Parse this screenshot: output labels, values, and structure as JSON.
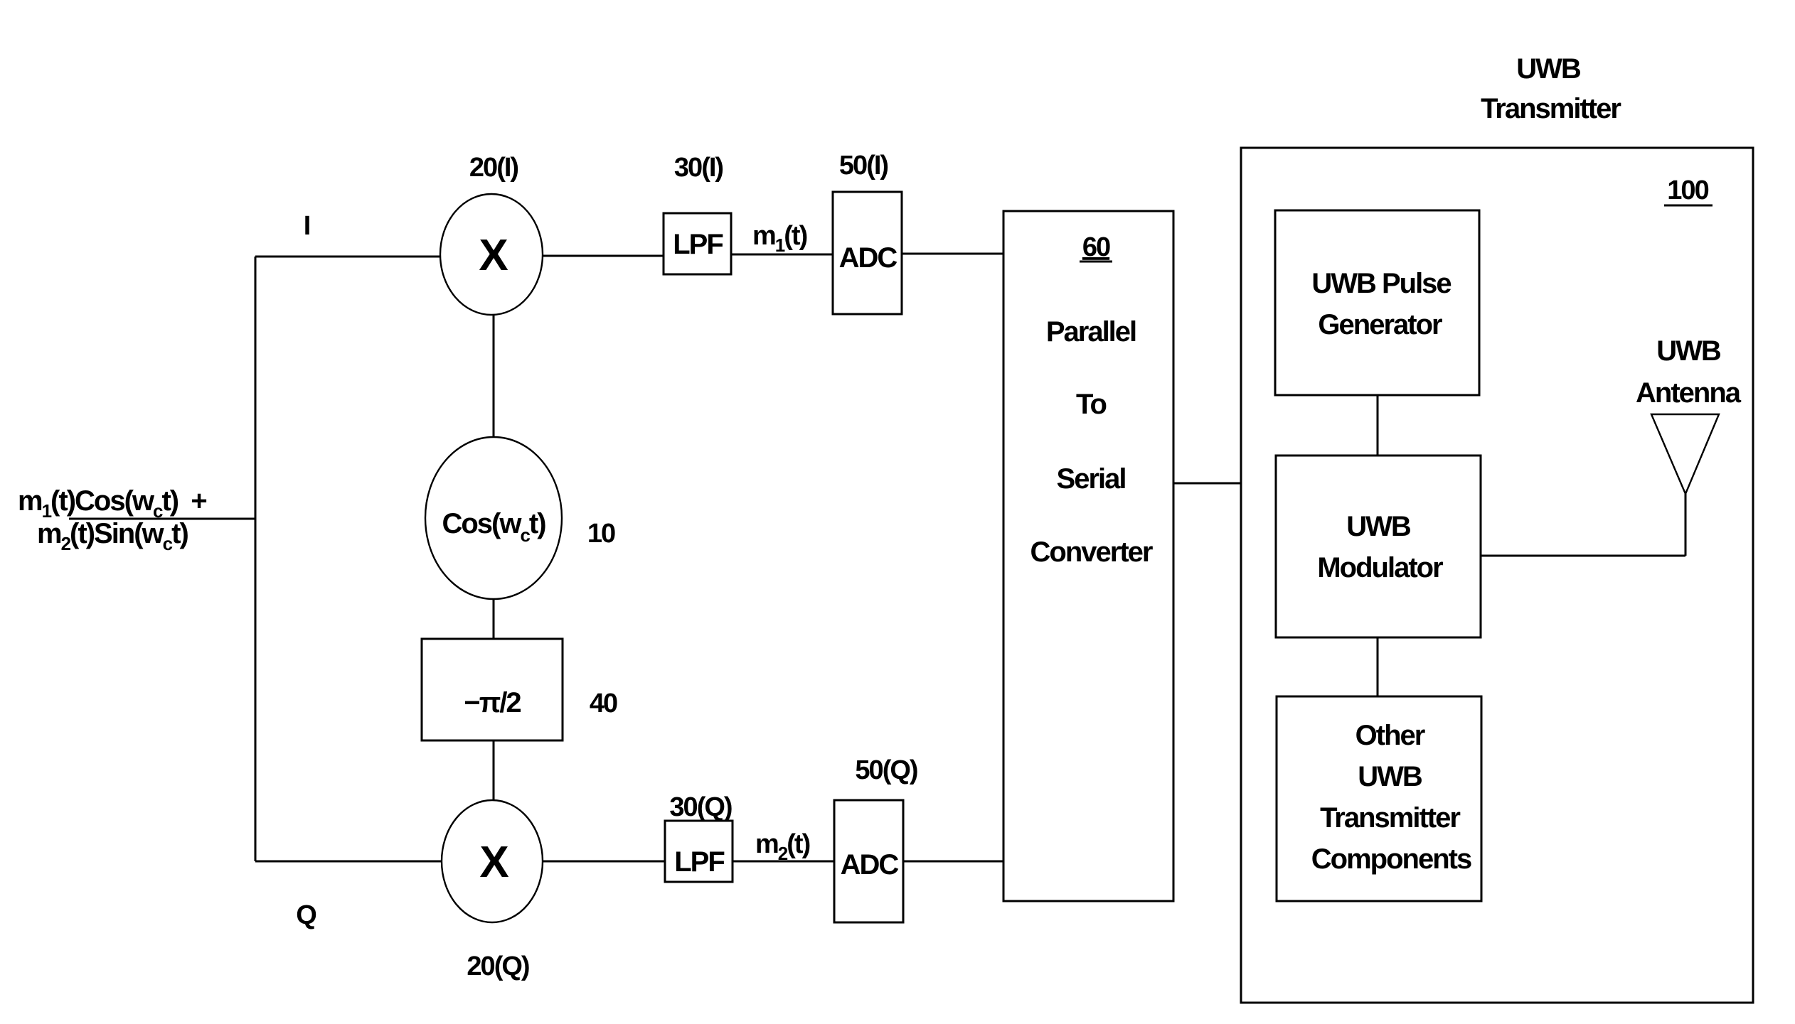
{
  "diagram": {
    "title": {
      "line1": "UWB",
      "line2": "Transmitter"
    },
    "input_signal": {
      "line1": {
        "a": "m",
        "a_sub": "1",
        "b": "(t)Cos(w",
        "c_sub": "c",
        "d": "t)  +"
      },
      "line2": {
        "a": "m",
        "a_sub": "2",
        "b": "(t)Sin(w",
        "c_sub": "c",
        "d": "t)"
      }
    },
    "branch_labels": {
      "i": "I",
      "q": "Q"
    },
    "mixer_i": {
      "symbol": "X",
      "ref": "20(I)"
    },
    "mixer_q": {
      "symbol": "X",
      "ref": "20(Q)"
    },
    "oscillator": {
      "text_a": "Cos(w",
      "text_sub": "c",
      "text_b": "t)",
      "ref": "10"
    },
    "phase_shifter": {
      "text": "−π/2",
      "ref": "40"
    },
    "lpf_i": {
      "label": "LPF",
      "ref": "30(I)",
      "output": {
        "a": "m",
        "sub": "1",
        "b": "(t)"
      }
    },
    "lpf_q": {
      "label": "LPF",
      "ref": "30(Q)",
      "output": {
        "a": "m",
        "sub": "2",
        "b": "(t)"
      }
    },
    "adc_i": {
      "label": "ADC",
      "ref": "50(I)"
    },
    "adc_q": {
      "label": "ADC",
      "ref": "50(Q)"
    },
    "p2s": {
      "ref": "60",
      "lines": [
        "Parallel",
        "To",
        "Serial",
        "Converter"
      ]
    },
    "transmitter": {
      "ref": "100",
      "pulse_generator": {
        "lines": [
          "UWB Pulse",
          "Generator"
        ]
      },
      "modulator": {
        "lines": [
          "UWB",
          "Modulator"
        ]
      },
      "other": {
        "lines": [
          "Other",
          "UWB",
          "Transmitter",
          "Components"
        ]
      },
      "antenna": {
        "lines": [
          "UWB",
          "Antenna"
        ],
        "icon": "antenna-icon"
      }
    }
  }
}
